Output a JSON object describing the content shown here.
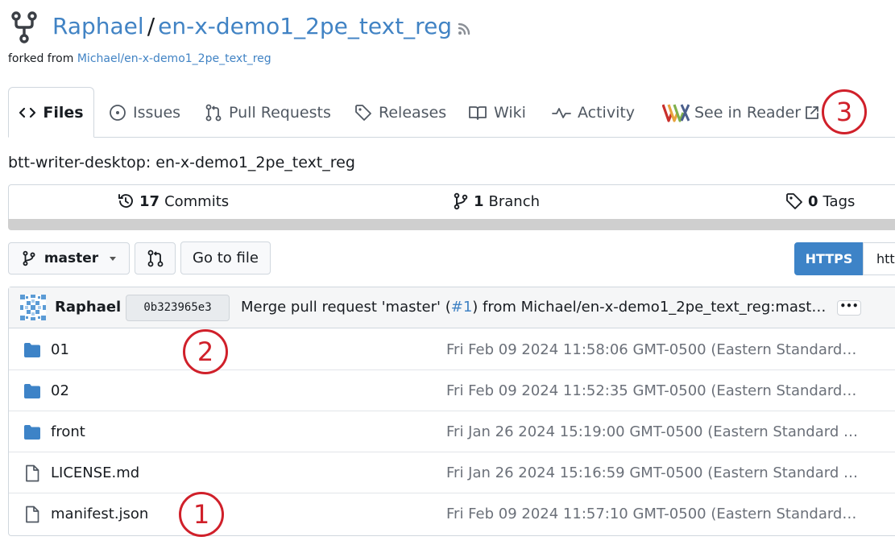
{
  "repo": {
    "owner": "Raphael",
    "separator": "/",
    "name": "en-x-demo1_2pe_text_reg",
    "forked_prefix": "forked from ",
    "forked_from": "Michael/en-x-demo1_2pe_text_reg",
    "description": "btt-writer-desktop: en-x-demo1_2pe_text_reg"
  },
  "tabs": [
    {
      "label": "Files",
      "icon": "code-icon"
    },
    {
      "label": "Issues",
      "icon": "issue-icon"
    },
    {
      "label": "Pull Requests",
      "icon": "pull-request-icon"
    },
    {
      "label": "Releases",
      "icon": "tag-icon"
    },
    {
      "label": "Wiki",
      "icon": "book-icon"
    },
    {
      "label": "Activity",
      "icon": "pulse-icon"
    },
    {
      "label": "See in Reader",
      "icon": "reader-logo-icon"
    }
  ],
  "annotations": [
    "1",
    "2",
    "3"
  ],
  "stats": {
    "commits_count": "17",
    "commits_label": "Commits",
    "branch_count": "1",
    "branch_label": "Branch",
    "tags_count": "0",
    "tags_label": "Tags"
  },
  "toolbar": {
    "branch": "master",
    "goto_label": "Go to file",
    "clone_protocol": "HTTPS",
    "clone_url_visible": "htt"
  },
  "latest_commit": {
    "author": "Raphael",
    "sha": "0b323965e3",
    "message_prefix": "Merge pull request 'master' (",
    "pr_link": "#1",
    "message_suffix": ") from Michael/en-x-demo1_2pe_text_reg:maste…",
    "more_label": "•••"
  },
  "files": [
    {
      "name": "01",
      "type": "folder",
      "date": "Fri Feb 09 2024 11:58:06 GMT-0500 (Eastern Standard Ti…"
    },
    {
      "name": "02",
      "type": "folder",
      "date": "Fri Feb 09 2024 11:52:35 GMT-0500 (Eastern Standard Ti…"
    },
    {
      "name": "front",
      "type": "folder",
      "date": "Fri Jan 26 2024 15:19:00 GMT-0500 (Eastern Standard Ti…"
    },
    {
      "name": "LICENSE.md",
      "type": "file",
      "date": "Fri Jan 26 2024 15:16:59 GMT-0500 (Eastern Standard Ti…"
    },
    {
      "name": "manifest.json",
      "type": "file",
      "date": "Fri Feb 09 2024 11:57:10 GMT-0500 (Eastern Standard Ti…"
    }
  ],
  "colors": {
    "link": "#4183c4",
    "annotation_red": "#d0202a",
    "folder_blue": "#3d83c7",
    "primary_button": "#3d83c7"
  }
}
